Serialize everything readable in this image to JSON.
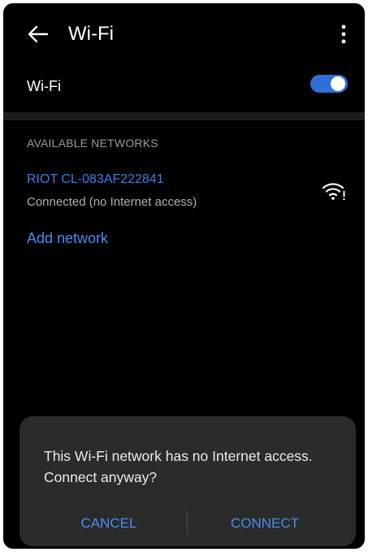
{
  "header": {
    "title": "Wi-Fi",
    "back_icon": "arrow-left-icon",
    "menu_icon": "more-vert-icon"
  },
  "wifi": {
    "label": "Wi-Fi",
    "enabled": true
  },
  "networks": {
    "section_title": "AVAILABLE NETWORKS",
    "items": [
      {
        "name": "RIOT CL-083AF222841",
        "status": "Connected (no Internet access)",
        "icon": "wifi-signal-icon"
      }
    ],
    "add_label": "Add network"
  },
  "dialog": {
    "message": "This Wi-Fi network has no Internet access. Connect anyway?",
    "cancel_label": "CANCEL",
    "connect_label": "CONNECT"
  },
  "colors": {
    "accent": "#3d7ee8",
    "background": "#000000",
    "dialog": "#2b2b2b"
  }
}
